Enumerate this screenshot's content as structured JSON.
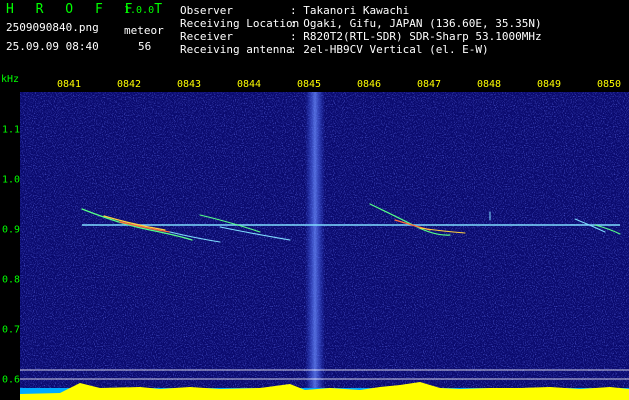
{
  "header": {
    "app_name": "H R O F F T",
    "app_version": "1.0.0",
    "file_name": "2509090840.png",
    "meteor_label": "meteor",
    "datetime": "25.09.09 08:40",
    "meteor_count": "56"
  },
  "station_info": {
    "labels": "Observer\nReceiving Location\nReceiver\nReceiving antenna",
    "values": ": Takanori Kawachi\n: Ogaki, Gifu, JAPAN (136.60E, 35.35N)\n: R820T2(RTL-SDR) SDR-Sharp 53.1000MHz\n: 2el-HB9CV Vertical (el. E-W)"
  },
  "spectrogram": {
    "frequency_unit": "kHz",
    "time_ticks": [
      "0841",
      "0842",
      "0843",
      "0844",
      "0845",
      "0846",
      "0847",
      "0848",
      "0849",
      "0850"
    ],
    "freq_ticks": [
      "1.1",
      "1.0",
      "0.9",
      "0.8",
      "0.7",
      "0.6"
    ],
    "colors": {
      "background": "#0a0a6e",
      "tick_time": "#ffff00",
      "tick_freq": "#00ff00",
      "baseline": "#ffff00",
      "floor": "#00aaff"
    }
  }
}
